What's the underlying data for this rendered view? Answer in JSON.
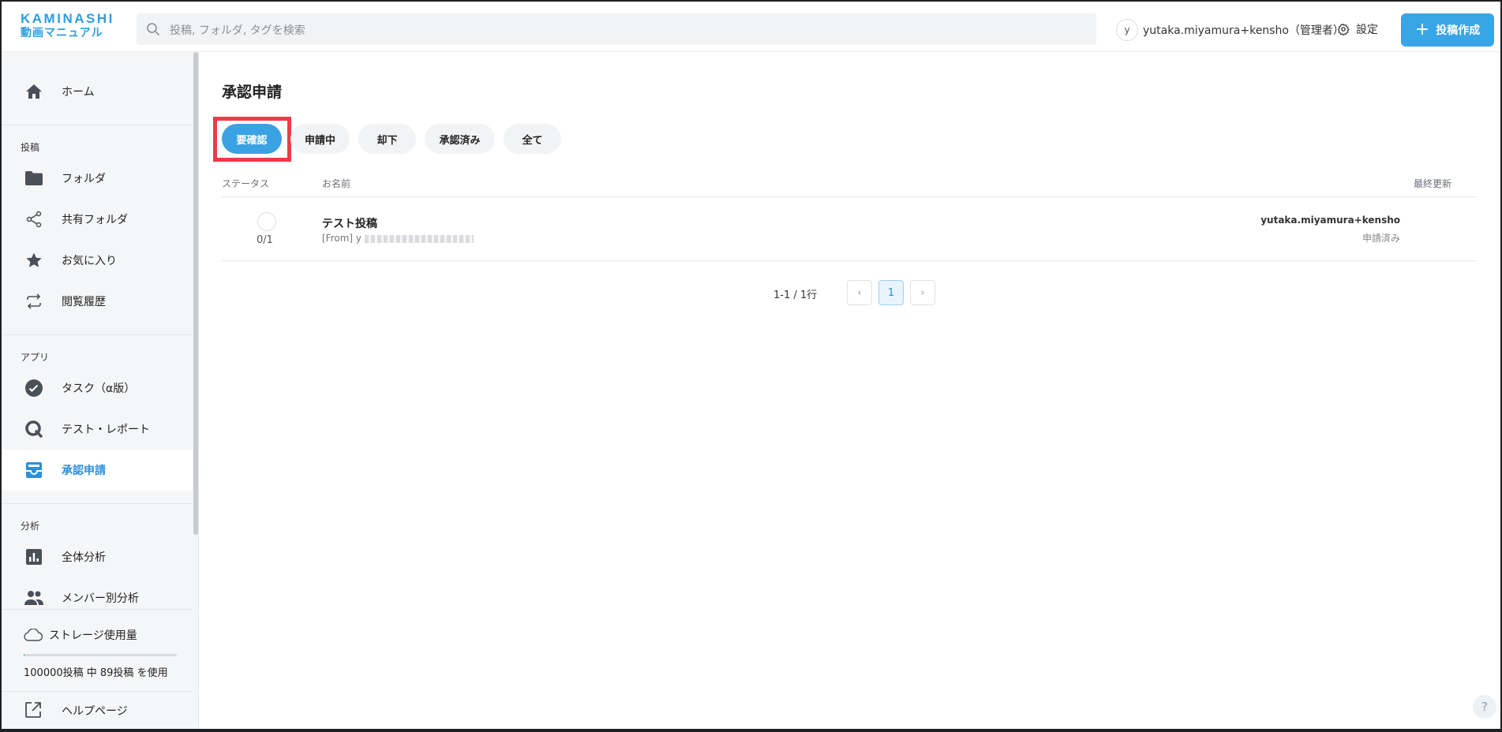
{
  "header": {
    "logo_line1": "KAMINASHI",
    "logo_line2": "動画マニュアル",
    "search_placeholder": "投稿, フォルダ, タグを検索",
    "avatar_initial": "y",
    "user_name": "yutaka.miyamura+kensho（管理者）",
    "settings_label": "設定",
    "create_label": "投稿作成"
  },
  "sidebar": {
    "home": "ホーム",
    "section_posts": "投稿",
    "folders": "フォルダ",
    "shared_folders": "共有フォルダ",
    "favorites": "お気に入り",
    "history": "閲覧履歴",
    "section_apps": "アプリ",
    "tasks": "タスク（α版）",
    "test_report": "テスト・レポート",
    "approval": "承認申請",
    "section_analytics": "分析",
    "overall_analytics": "全体分析",
    "member_analytics": "メンバー別分析",
    "storage_title": "ストレージ使用量",
    "storage_usage": "100000投稿 中 89投稿 を使用",
    "storage_fraction": 0.00089,
    "help": "ヘルプページ"
  },
  "main": {
    "title": "承認申請",
    "filters": [
      "要確認",
      "申請中",
      "却下",
      "承認済み",
      "全て"
    ],
    "active_filter": "要確認",
    "columns": {
      "status": "ステータス",
      "name": "お名前",
      "updated": "最終更新"
    },
    "rows": [
      {
        "status_count": "0/1",
        "title": "テスト投稿",
        "from_prefix": "[From]",
        "from_value": "y",
        "updated_by": "yutaka.miyamura+kensho",
        "updated_status": "申請済み"
      }
    ],
    "pagination": {
      "info": "1-1 / 1行",
      "current_page": "1",
      "prev": "‹",
      "next": "›"
    },
    "help_fab": "?"
  },
  "colors": {
    "accent": "#38a5e6",
    "highlight_border": "#ee3b48",
    "sidebar_bg": "#f5f6f8"
  }
}
